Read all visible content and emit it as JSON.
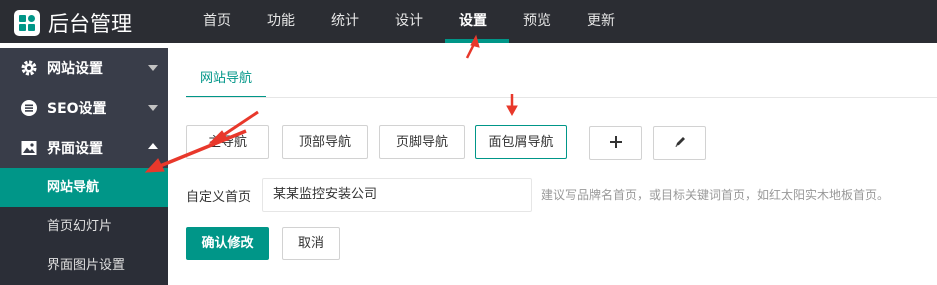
{
  "app": {
    "title": "后台管理",
    "icon": "grid-logo-icon"
  },
  "topnav": {
    "items": [
      "首页",
      "功能",
      "统计",
      "设计",
      "设置",
      "预览",
      "更新"
    ],
    "active": "设置"
  },
  "sidebar": {
    "groups": [
      {
        "label": "网站设置",
        "icon": "gear-icon",
        "expanded": false
      },
      {
        "label": "SEO设置",
        "icon": "list-icon",
        "expanded": false
      },
      {
        "label": "界面设置",
        "icon": "image-icon",
        "expanded": true
      }
    ],
    "sub_items": [
      "网站导航",
      "首页幻灯片",
      "界面图片设置"
    ],
    "active_sub": "网站导航"
  },
  "content": {
    "tab": "网站导航",
    "nav_buttons": [
      "主导航",
      "顶部导航",
      "页脚导航",
      "面包屑导航"
    ],
    "selected_button": "面包屑导航",
    "add_icon": "plus-icon",
    "edit_icon": "pencil-icon",
    "form": {
      "label": "自定义首页",
      "value": "某某监控安装公司",
      "hint": "建议写品牌名首页，或目标关键词首页，如红太阳实木地板首页。"
    },
    "confirm_label": "确认修改",
    "cancel_label": "取消"
  },
  "colors": {
    "accent": "#009688",
    "topbar": "#2b2d33",
    "sidebar": "#393d49",
    "arrow": "#e8382b"
  }
}
